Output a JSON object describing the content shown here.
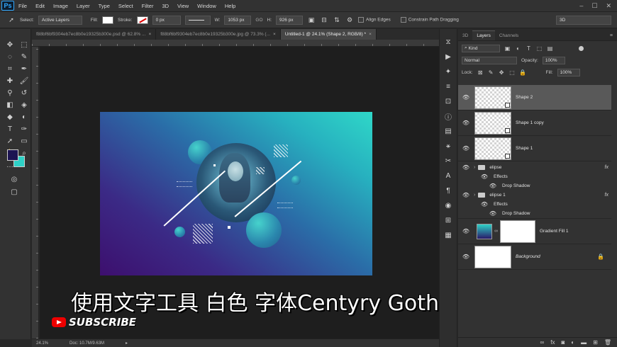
{
  "app": {
    "logo": "Ps",
    "menu": [
      "File",
      "Edit",
      "Image",
      "Layer",
      "Type",
      "Select",
      "Filter",
      "3D",
      "View",
      "Window",
      "Help"
    ]
  },
  "options": {
    "select_label": "Select:",
    "select_value": "Active Layers",
    "fill_label": "Fill:",
    "stroke_label": "Stroke:",
    "stroke_width": "0 px",
    "w_label": "W:",
    "w_value": "1053 px",
    "go_label": "GO",
    "h_label": "H:",
    "h_value": "926 px",
    "align_edges": "Align Edges",
    "constrain": "Constrain Path Dragging",
    "workspace": "3D"
  },
  "tabs": [
    {
      "label": "f88bf6bf9304eb7ec8b0e19325b300e.psd @ 62.8% ...",
      "close": "×"
    },
    {
      "label": "f88bf6bf9304eb7ec8b0e19325b300e.jpg @ 73.3% (...",
      "close": "×"
    },
    {
      "label": "Untitled-1 @ 24.1% (Shape 2, RGB/8) *",
      "close": "×"
    }
  ],
  "status": {
    "zoom": "24.1%",
    "doc": "Doc: 10.7M/9.63M"
  },
  "overlay": {
    "subtitle": "使用文字工具 白色 字体Centyry Gothic Bold",
    "subscribe": "SUBSCRIBE"
  },
  "panel": {
    "tab_3d": "3D",
    "tab_layers": "Layers",
    "tab_channels": "Channels",
    "kind": "Kind",
    "blend_mode": "Normal",
    "opacity_label": "Opacity:",
    "opacity_value": "100%",
    "lock_label": "Lock:",
    "fill_label": "Fill:",
    "fill_value": "100%"
  },
  "layers": {
    "shape2": "Shape 2",
    "shape1copy": "Shape 1 copy",
    "shape1": "Shape 1",
    "elipse": "elipse",
    "elipse_effects": "Effects",
    "elipse_drop": "Drop Shadow",
    "elipse1": "elipse 1",
    "elipse1_effects": "Effects",
    "elipse1_drop": "Drop Shadow",
    "gradient": "Gradient Fill 1",
    "background": "Background",
    "fx": "fx"
  },
  "colors": {
    "foreground": "#1c1452",
    "background": "#2ed1c6"
  }
}
